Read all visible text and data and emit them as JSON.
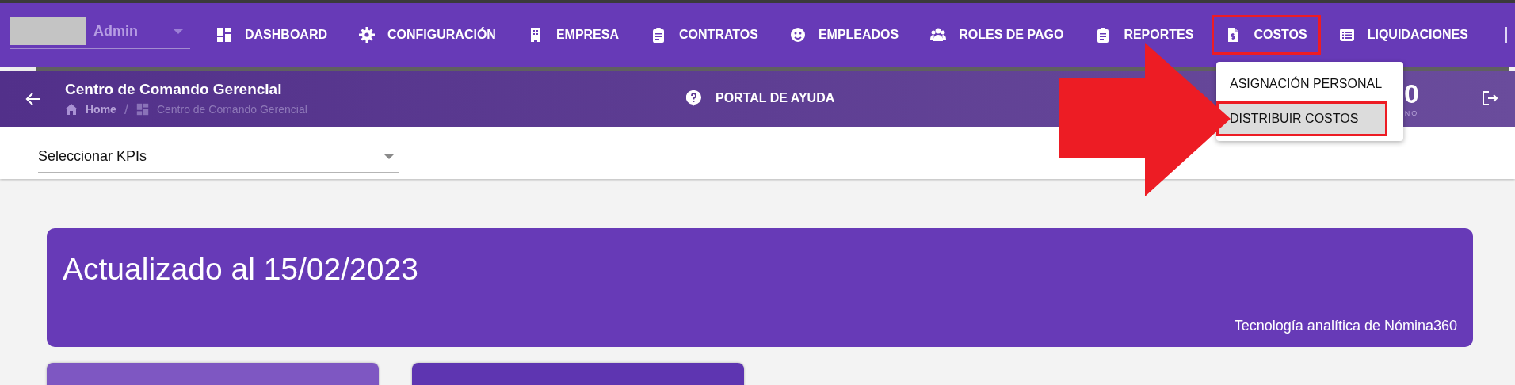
{
  "user_select": {
    "value": "Admin"
  },
  "nav": [
    {
      "label": "DASHBOARD",
      "selected": false
    },
    {
      "label": "CONFIGURACIÓN",
      "selected": false
    },
    {
      "label": "EMPRESA",
      "selected": false
    },
    {
      "label": "CONTRATOS",
      "selected": false
    },
    {
      "label": "EMPLEADOS",
      "selected": false
    },
    {
      "label": "ROLES DE PAGO",
      "selected": false
    },
    {
      "label": "REPORTES",
      "selected": false
    },
    {
      "label": "COSTOS",
      "selected": true
    },
    {
      "label": "LIQUIDACIONES",
      "selected": false
    }
  ],
  "progress": {
    "level": 0.018
  },
  "dropdown_menu": [
    {
      "label": "ASIGNACIÓN PERSONAL",
      "selected": false
    },
    {
      "label": "DISTRIBUIR COSTOS",
      "selected": true
    }
  ],
  "header": {
    "title": "Centro de Comando Gerencial",
    "breadcrumb": [
      "Home",
      "Centro de Comando Gerencial"
    ],
    "breadcrumb_separator": "/",
    "help": "PORTAL DE AYUDA",
    "stat_value": "0",
    "stat_label": "NO"
  },
  "kpi_select": {
    "value": "Seleccionar KPIs"
  },
  "banner": {
    "title": "Actualizado al 15/02/2023",
    "subtitle": "Tecnología analítica de Nómina360"
  },
  "cards": [
    {
      "color": "#7e57c2"
    },
    {
      "color": "#5e35b1"
    }
  ]
}
